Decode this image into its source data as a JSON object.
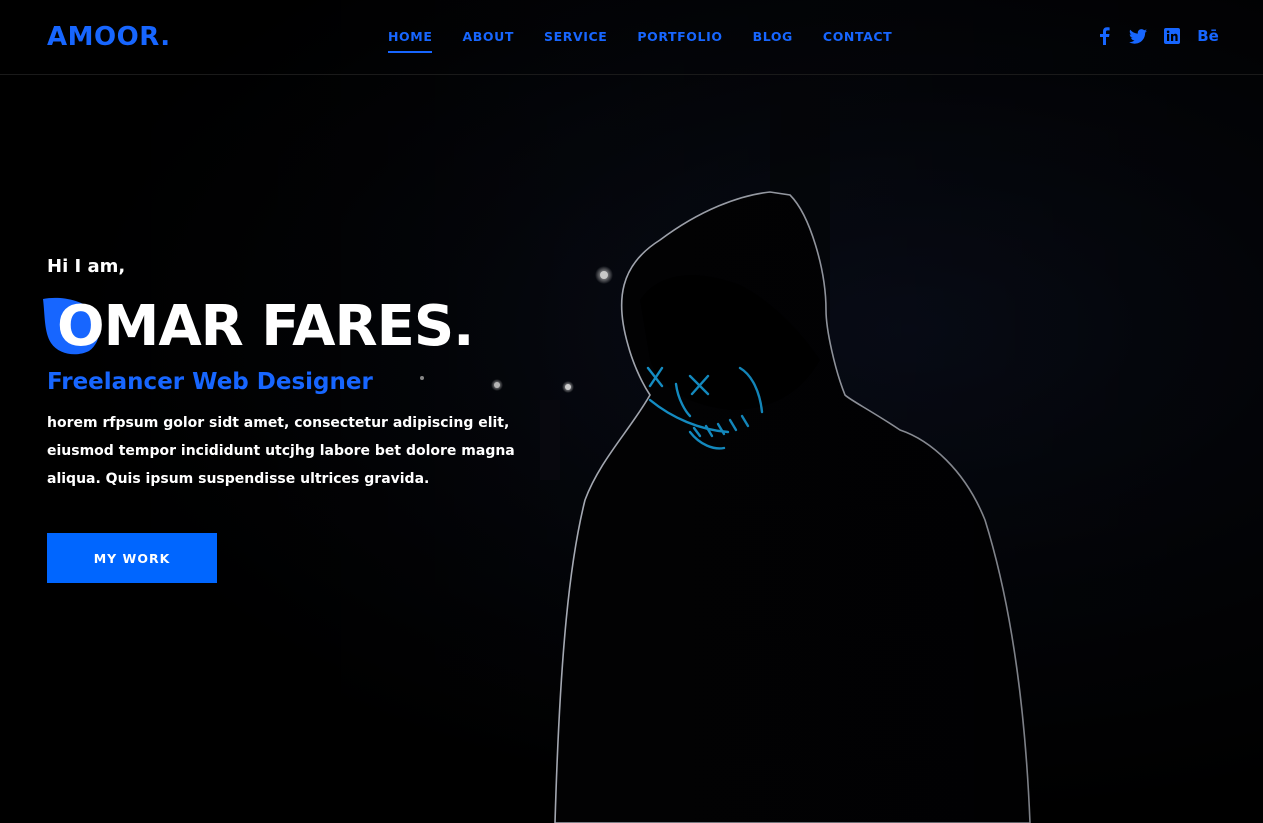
{
  "brand": {
    "logo_text": "AMOOR.",
    "accent_color": "#1766ff"
  },
  "nav": {
    "items": [
      {
        "label": "HOME",
        "active": true
      },
      {
        "label": "ABOUT",
        "active": false
      },
      {
        "label": "SERVICE",
        "active": false
      },
      {
        "label": "PORTFOLIO",
        "active": false
      },
      {
        "label": "BLOG",
        "active": false
      },
      {
        "label": "CONTACT",
        "active": false
      }
    ]
  },
  "social": {
    "icons": [
      "facebook-icon",
      "twitter-icon",
      "linkedin-icon",
      "behance-icon"
    ],
    "behance_label": "Bē"
  },
  "hero": {
    "greeting": "Hi I am,",
    "name": "OMAR FARES.",
    "role": "Freelancer Web Designer",
    "bio": "horem rfpsum golor sidt amet, consectetur adipiscing elit, eiusmod tempor incididunt utcjhg labore bet dolore magna aliqua. Quis ipsum suspendisse ultrices gravida.",
    "cta_label": "MY WORK",
    "cta_color": "#0066ff"
  }
}
